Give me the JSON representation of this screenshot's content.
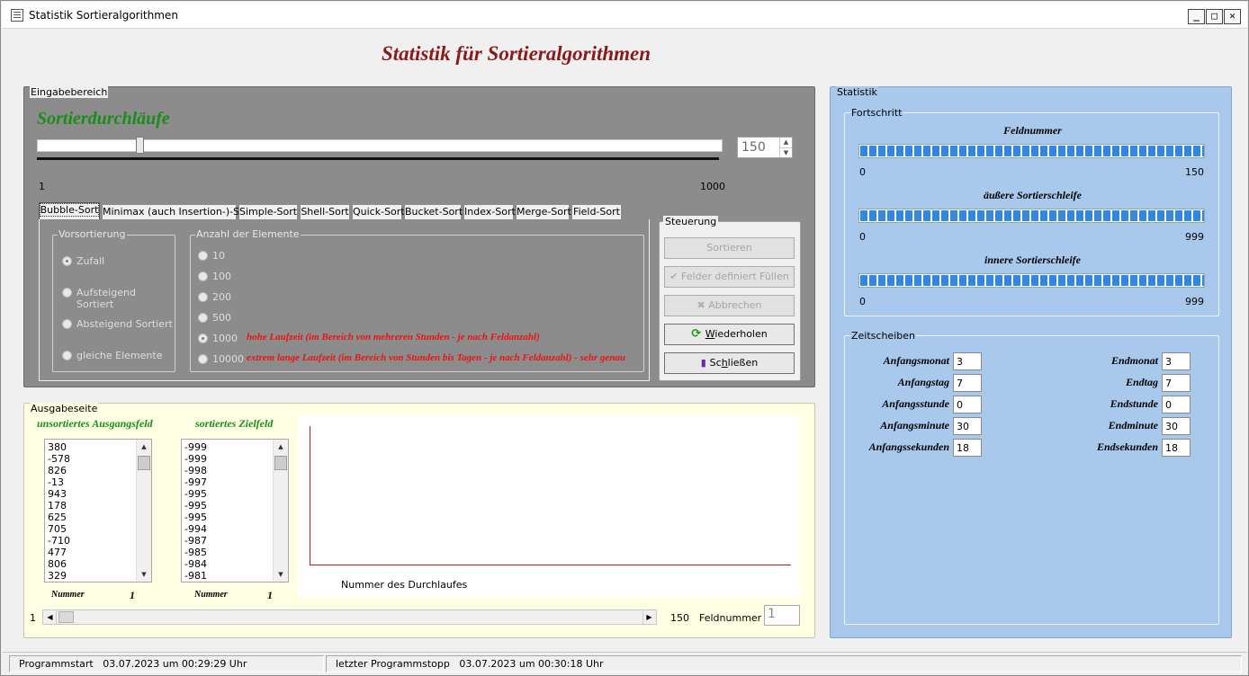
{
  "window": {
    "title": "Statistik Sortieralgorithmen"
  },
  "main_title": "Statistik für Sortieralgorithmen",
  "input": {
    "group_label": "Eingabebereich",
    "heading": "Sortierdurchläufe",
    "slider": {
      "value": 150,
      "min_label": "1",
      "max_label": "1000",
      "fraction": 0.15
    },
    "spin_value": "150",
    "tabs": [
      "Bubble-Sort",
      "Minimax (auch Insertion-)-Sort",
      "Simple-Sort",
      "Shell-Sort",
      "Quick-Sort",
      "Bucket-Sort",
      "Index-Sort",
      "Merge-Sort",
      "Field-Sort"
    ],
    "presort": {
      "label": "Vorsortierung",
      "options": [
        "Zufall",
        "Aufsteigend Sortiert",
        "Absteigend Sortiert",
        "gleiche Elemente"
      ],
      "selected": "Zufall"
    },
    "count": {
      "label": "Anzahl der Elemente",
      "options": [
        "10",
        "100",
        "200",
        "500",
        "1000",
        "10000"
      ],
      "selected": "1000",
      "note_1000": "hohe Laufzeit (im Bereich von mehreren Stunden - je nach Feldanzahl)",
      "note_10000": "extrem lange Laufzeit (im Bereich von Stunden bis Tagen - je nach Feldanzahl) - sehr genau"
    }
  },
  "control": {
    "label": "Steuerung",
    "sort": "Sortieren",
    "fill": "Felder definiert Füllen",
    "abort": "Abbrechen",
    "repeat": "Wiederholen",
    "close": "Schließen"
  },
  "output": {
    "group_label": "Ausgabeseite",
    "unsorted_title": "unsortiertes Ausgangsfeld",
    "sorted_title": "sortiertes Zielfeld",
    "unsorted_values": [
      "380",
      "-578",
      "826",
      "-13",
      "943",
      "178",
      "625",
      "705",
      "-710",
      "477",
      "806",
      "329"
    ],
    "sorted_values": [
      "-999",
      "-999",
      "-998",
      "-997",
      "-995",
      "-995",
      "-995",
      "-994",
      "-987",
      "-985",
      "-984",
      "-981"
    ],
    "number_label": "Nummer",
    "unsorted_number": "1",
    "sorted_number": "1",
    "chart_caption": "Nummer des Durchlaufes",
    "scroll_min": "1",
    "scroll_max": "150",
    "field_label": "Feldnummer",
    "field_value": "1"
  },
  "stats": {
    "group_label": "Statistik",
    "progress_label": "Fortschritt",
    "bars": [
      {
        "title": "Feldnummer",
        "min": "0",
        "max": "150",
        "fraction": 1.0
      },
      {
        "title": "äußere Sortierschleife",
        "min": "0",
        "max": "999",
        "fraction": 1.0
      },
      {
        "title": "innere Sortierschleife",
        "min": "0",
        "max": "999",
        "fraction": 1.0
      }
    ],
    "time_label": "Zeitscheiben",
    "start": [
      {
        "label": "Anfangsmonat",
        "value": "3"
      },
      {
        "label": "Anfangstag",
        "value": "7"
      },
      {
        "label": "Anfangsstunde",
        "value": "0"
      },
      {
        "label": "Anfangsminute",
        "value": "30"
      },
      {
        "label": "Anfangssekunden",
        "value": "18"
      }
    ],
    "end": [
      {
        "label": "Endmonat",
        "value": "3"
      },
      {
        "label": "Endtag",
        "value": "7"
      },
      {
        "label": "Endstunde",
        "value": "0"
      },
      {
        "label": "Endminute",
        "value": "30"
      },
      {
        "label": "Endsekunden",
        "value": "18"
      }
    ]
  },
  "status": {
    "start_label": "Programmstart",
    "start_value": "03.07.2023  um 00:29:29 Uhr",
    "stop_label": "letzter Programmstopp",
    "stop_value": "03.07.2023  um 00:30:18 Uhr"
  },
  "colors": {
    "title_red": "#8b1a1a",
    "heading_green": "#1a8c1a",
    "note_red": "#ee1111",
    "progress_blue": "#3388dd",
    "chart_line": "#aa2222"
  }
}
